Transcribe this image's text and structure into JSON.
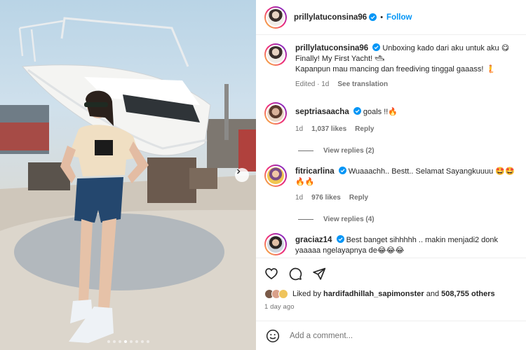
{
  "post": {
    "username": "prillylatuconsina96",
    "separator": "•",
    "follow_label": "Follow",
    "caption_lines": [
      "Unboxing kado dari aku untuk aku 😋",
      "Finally! My First Yacht! 🛥",
      "Kapanpun mau mancing dan freediving tinggal gaaass! 🧜"
    ],
    "caption_edited": "Edited · 1d",
    "see_translation": "See translation",
    "slide_count": 8,
    "active_slide_index": 3
  },
  "comments": [
    {
      "username": "septriasaacha",
      "text": "goals !!🔥",
      "time": "1d",
      "likes": "1,037 likes",
      "reply_label": "Reply",
      "view_replies": "View replies (2)"
    },
    {
      "username": "fitricarlina",
      "text": "Wuaaachh.. Bestt.. Selamat Sayangkuuuu 🤩🤩🔥🔥",
      "time": "1d",
      "likes": "976 likes",
      "reply_label": "Reply",
      "view_replies": "View replies (4)"
    },
    {
      "username": "graciaz14",
      "text": "Best banget sihhhhh .. makin menjadi2 donk yaaaaa ngelayapnya de😂😂😂"
    }
  ],
  "likes": {
    "prefix": "Liked by ",
    "user": "hardifadhillah_sapimonster",
    "middle": " and ",
    "others": "508,755 others"
  },
  "time_ago": "1 day ago",
  "add_comment": {
    "placeholder": "Add a comment..."
  },
  "icons": {
    "like": "heart-icon",
    "comment": "comment-icon",
    "share": "send-icon",
    "emoji": "emoji-icon",
    "verified": "verified-badge-icon",
    "next": "chevron-right-icon"
  },
  "colors": {
    "accent": "#0095f6",
    "verified": "#0095f6",
    "muted": "#737373"
  }
}
